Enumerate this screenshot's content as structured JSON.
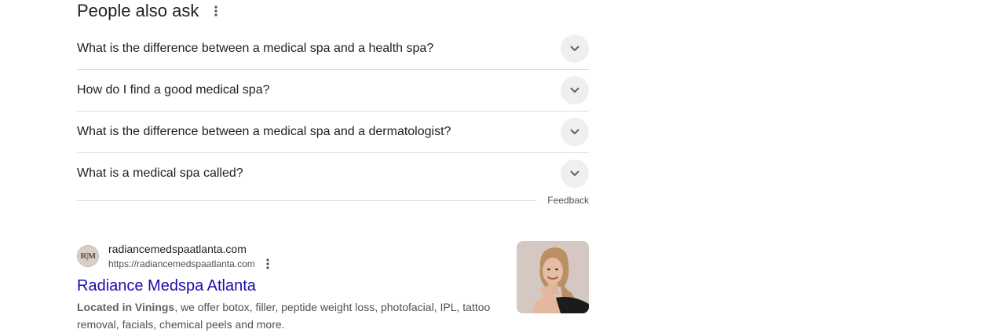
{
  "paa": {
    "title": "People also ask",
    "questions": [
      "What is the difference between a medical spa and a health spa?",
      "How do I find a good medical spa?",
      "What is the difference between a medical spa and a dermatologist?",
      "What is a medical spa called?"
    ],
    "feedback_label": "Feedback"
  },
  "result": {
    "favicon_text": "R|M",
    "site_name": "radiancemedspaatlanta.com",
    "url": "https://radiancemedspaatlanta.com",
    "title": "Radiance Medspa Atlanta",
    "snippet_emphasis": "Located in Vinings",
    "snippet_rest": ", we offer botox, filler, peptide weight loss, photofacial, IPL, tattoo removal, facials, chemical peels and more.",
    "link_color": "#1a0dab"
  },
  "icons": {
    "paa_menu": "more-vert-icon",
    "question_expand": "chevron-down-icon",
    "result_menu": "more-vert-icon",
    "thumbnail": "portrait-photo"
  }
}
